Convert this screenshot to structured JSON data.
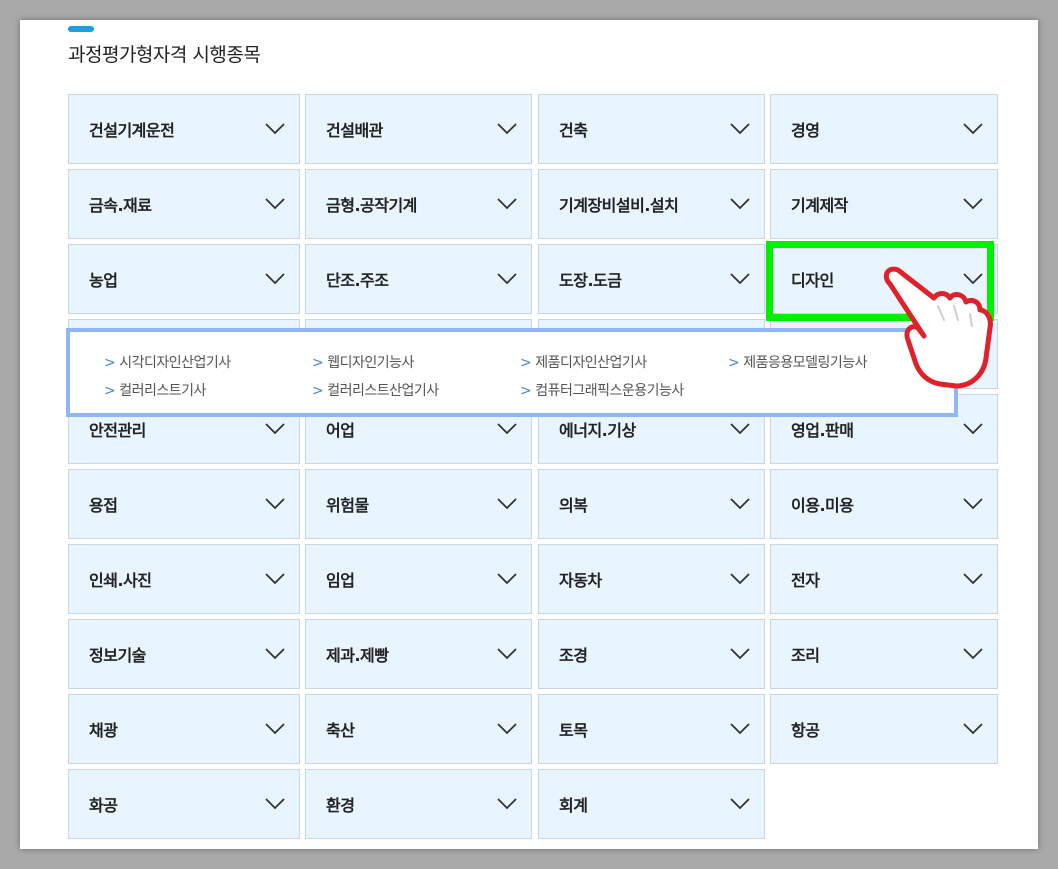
{
  "section": {
    "title": "과정평가형자격 시행종목"
  },
  "categories": [
    "건설기계운전",
    "건설배관",
    "건축",
    "경영",
    "금속.재료",
    "금형.공작기계",
    "기계장비설비.설치",
    "기계제작",
    "농업",
    "단조.주조",
    "도장.도금",
    "디자인",
    "안전관리",
    "어업",
    "에너지.기상",
    "영업.판매",
    "용접",
    "위험물",
    "의복",
    "이용.미용",
    "인쇄.사진",
    "임업",
    "자동차",
    "전자",
    "정보기술",
    "제과.제빵",
    "조경",
    "조리",
    "채광",
    "축산",
    "토목",
    "항공",
    "화공",
    "환경",
    "회계"
  ],
  "selected_category": "디자인",
  "dropdown": {
    "caret": ">",
    "items": [
      "시각디자인산업기사",
      "웹디자인기능사",
      "제품디자인산업기사",
      "제품응용모델링기능사",
      "컬러리스트기사",
      "컬러리스트산업기사",
      "컴퓨터그래픽스운용기능사"
    ]
  },
  "colors": {
    "cell_bg": "#e8f4fe",
    "cell_border": "#c9d6e2",
    "accent": "#1aa0e0",
    "highlight": "#00f000",
    "dropdown_border": "#8fb7f5",
    "hand_outline": "#e0202a"
  },
  "icons": {
    "chevron": "chevron-down-icon",
    "pointer": "pointing-hand-icon"
  }
}
